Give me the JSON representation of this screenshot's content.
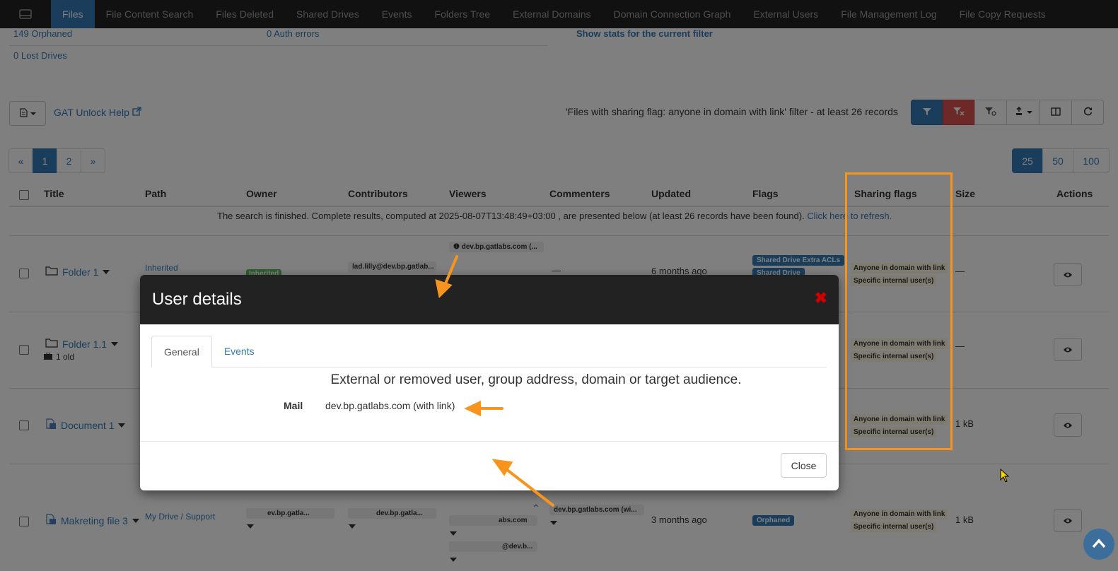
{
  "nav": {
    "items": [
      "Files",
      "File Content Search",
      "Files Deleted",
      "Shared Drives",
      "Events",
      "Folders Tree",
      "External Domains",
      "Domain Connection Graph",
      "External Users",
      "File Management Log",
      "File Copy Requests"
    ]
  },
  "stats": {
    "orphaned": "149 Orphaned",
    "auth_errors": "0 Auth errors",
    "show_stats": "Show stats for the current filter",
    "lost_drives": "0 Lost Drives"
  },
  "toolbar": {
    "help_link": "GAT Unlock Help",
    "filter_text": "'Files with sharing flag: anyone in domain with link' filter -  at least 26 records"
  },
  "pagination": {
    "pages": [
      "«",
      "1",
      "2",
      "»"
    ],
    "sizes": [
      "25",
      "50",
      "100"
    ]
  },
  "table": {
    "headers": [
      "Title",
      "Path",
      "Owner",
      "Contributors",
      "Viewers",
      "Commenters",
      "Updated",
      "Flags",
      "Sharing flags",
      "Size",
      "Actions"
    ],
    "search_message": "The search is finished. Complete results, computed at 2025-08-07T13:48:49+03:00 , are presented below (at least 26 records have been found).",
    "refresh_link": "Click here to refresh.",
    "rows": [
      {
        "title": "Folder 1",
        "path": "Inherited",
        "owner": "Inherited",
        "contributor": "lad.lilly@dev.bp.gatlab...",
        "viewer": "dev.bp.gatlabs.com (...",
        "commenter": "—",
        "updated": "6 months ago",
        "flags": [
          "Shared Drive Extra ACLs",
          "Shared Drive"
        ],
        "sharing_flags": [
          "Anyone in domain with link",
          "Specific internal user(s)"
        ],
        "size": "—"
      },
      {
        "title": "Folder 1.1",
        "subtitle": "1 old",
        "sharing_flags": [
          "Anyone in domain with link",
          "Specific internal user(s)"
        ],
        "size": "—"
      },
      {
        "title": "Document 1",
        "sharing_flags": [
          "Anyone in domain with link",
          "Specific internal user(s)"
        ],
        "size": "1 kB"
      },
      {
        "title": "Makreting file 3",
        "path": "My Drive / Support",
        "owner": "ev.bp.gatla...",
        "contributor": "dev.bp.gatla...",
        "viewer_1": "abs.com",
        "viewer_2": "@dev.b...",
        "commenter": "dev.bp.gatlabs.com (wi...",
        "updated": "3 months ago",
        "flags": [
          "Orphaned"
        ],
        "sharing_flags": [
          "Anyone in domain with link",
          "Specific internal user(s)"
        ],
        "size": "1 kB"
      }
    ]
  },
  "modal": {
    "title": "User details",
    "tabs": [
      "General",
      "Events"
    ],
    "description": "External or removed user, group address, domain or target audience.",
    "mail_label": "Mail",
    "mail_value": "dev.bp.gatlabs.com (with link)",
    "close_label": "Close"
  },
  "colors": {
    "accent": "#337ab7",
    "danger": "#d9534f",
    "annotation": "#f7941d",
    "navbar": "#222222"
  }
}
